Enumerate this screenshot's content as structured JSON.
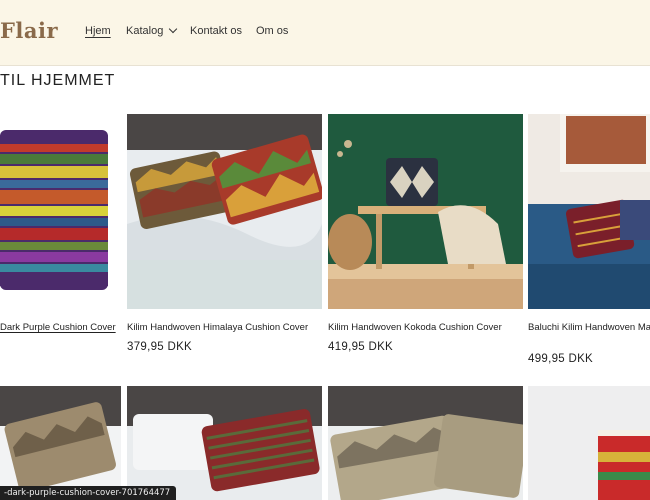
{
  "header": {
    "logo": "Flair",
    "nav": [
      {
        "label": "Hjem",
        "active": true
      },
      {
        "label": "Katalog",
        "dropdown": true
      },
      {
        "label": "Kontakt os"
      },
      {
        "label": "Om os"
      }
    ]
  },
  "section": {
    "title": "TIL HJEMMET"
  },
  "products": [
    {
      "title": "Dark Purple Cushion Cover",
      "price": ""
    },
    {
      "title": "Kilim Handwoven Himalaya Cushion Cover",
      "price": "379,95 DKK"
    },
    {
      "title": "Kilim Handwoven Kokoda Cushion Cover",
      "price": "419,95 DKK"
    },
    {
      "title": "Baluchi Kilim Handwoven Ma... Cushion Cover",
      "price": "499,95 DKK"
    }
  ],
  "status_url": "-dark-purple-cushion-cover-701764477",
  "colors": {
    "header_bg": "#fbf6e7",
    "logo": "#8a6a4a"
  }
}
